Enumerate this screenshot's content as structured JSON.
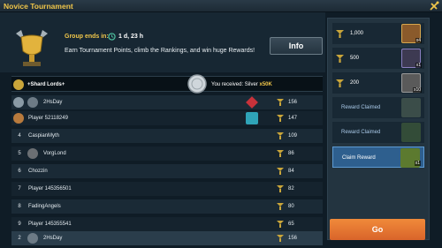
{
  "window": {
    "title": "Novice Tournament"
  },
  "header": {
    "group_label": "Group ends in:",
    "group_time": "1 d, 23 h",
    "description": "Earn Tournament Points, climb the Rankings, and win huge Rewards!",
    "info_label": "Info"
  },
  "notification": {
    "clan": "+Shard Lords+",
    "message": "You received: Silver ",
    "amount": "x50K"
  },
  "leaderboard": [
    {
      "rank": "",
      "name": "2HsDay",
      "points": "156",
      "reward_count": "x1"
    },
    {
      "rank": "",
      "name": "Player 52118249",
      "points": "147",
      "reward_count": "x1"
    },
    {
      "rank": "4",
      "name": "CaspianMyth",
      "points": "109"
    },
    {
      "rank": "5",
      "name": "VorgLond",
      "points": "86"
    },
    {
      "rank": "6",
      "name": "Chozzin",
      "points": "84"
    },
    {
      "rank": "7",
      "name": "Player 145356501",
      "points": "82"
    },
    {
      "rank": "8",
      "name": "FadingAngels",
      "points": "80"
    },
    {
      "rank": "9",
      "name": "Player 145355541",
      "points": "65"
    }
  ],
  "my_row": {
    "rank": "2",
    "name": "2HsDay",
    "points": "156"
  },
  "rewards": [
    {
      "points": "1,000",
      "count": "x4"
    },
    {
      "points": "500",
      "count": "x1"
    },
    {
      "points": "200",
      "count": "x10"
    },
    {
      "label": "Reward Claimed"
    },
    {
      "label": "Reward Claimed"
    },
    {
      "label": "Claim Reward",
      "count": "x1"
    }
  ],
  "go_label": "Go",
  "colors": {
    "accent": "#f0c64a",
    "go": "#e8763a",
    "claim": "#2e5f8e"
  }
}
